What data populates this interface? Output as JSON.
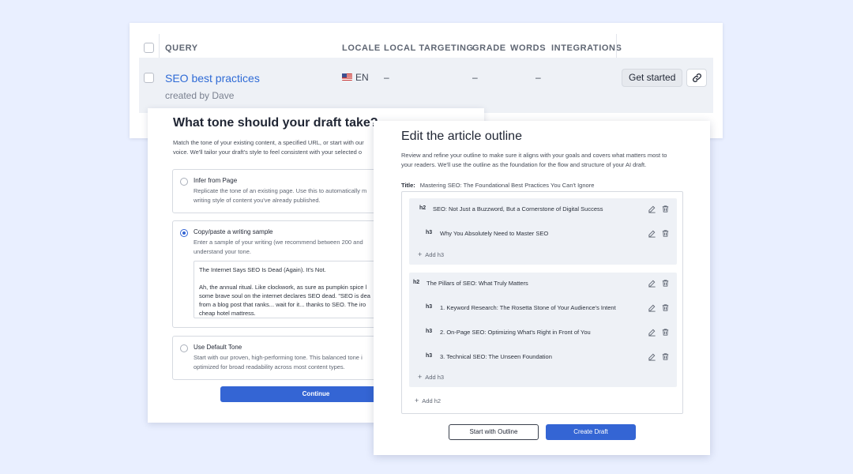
{
  "table": {
    "columns": [
      "QUERY",
      "LOCALE",
      "LOCAL TARGETING",
      "GRADE",
      "WORDS",
      "INTEGRATIONS"
    ],
    "row": {
      "query": "SEO best practices",
      "created_by": "created by Dave",
      "flag": "us-flag-icon",
      "locale": "EN",
      "local_targeting": "–",
      "grade": "–",
      "words": "–",
      "action_label": "Get started"
    }
  },
  "tone": {
    "title": "What tone should your draft take?",
    "desc_line1": "Match the tone of your existing content, a specified URL, or start with our",
    "desc_line2": "voice. We'll tailor your draft's style to feel consistent with your selected o",
    "options": [
      {
        "title": "Infer from Page",
        "desc1": "Replicate the tone of an existing page. Use this to automatically m",
        "desc2": "writing style of content you've already published.",
        "selected": false
      },
      {
        "title": "Copy/paste a writing sample",
        "desc1": "Enter a sample of your writing (we recommend between 200 and",
        "desc2": "understand your tone.",
        "selected": true
      },
      {
        "title": "Use Default Tone",
        "desc1": "Start with our proven, high-performing tone. This balanced tone i",
        "desc2": "optimized for broad readability across most content types.",
        "selected": false
      }
    ],
    "sample": {
      "line1": "The Internet Says SEO Is Dead (Again). It's Not.",
      "line2": "Ah, the annual ritual. Like clockwork, as sure as pumpkin spice l",
      "line3": "some brave soul on the internet declares SEO dead. \"SEO is dea",
      "line4": "from a blog post that ranks... wait for it... thanks to SEO. The iro",
      "line5": "cheap hotel mattress."
    },
    "continue_label": "Continue"
  },
  "outline": {
    "title": "Edit the article outline",
    "desc_line1": "Review and refine your outline to make sure it aligns with your goals and covers what matters most to",
    "desc_line2": "your readers. We'll use the outline as the foundation for the flow and structure of your AI draft.",
    "title_label": "Title:",
    "title_value": "Mastering SEO: The Foundational Best Practices You Can't Ignore",
    "sections": [
      {
        "h2": "SEO: Not Just a Buzzword, But a Cornerstone of Digital Success",
        "h3": [
          "Why You Absolutely Need to Master SEO"
        ]
      },
      {
        "h2": "The Pillars of SEO: What Truly Matters",
        "h3": [
          "1. Keyword Research: The Rosetta Stone of Your Audience's Intent",
          "2. On-Page SEO: Optimizing What's Right in Front of You",
          "3. Technical SEO: The Unseen Foundation"
        ]
      }
    ],
    "h2_tag": "h2",
    "h3_tag": "h3",
    "add_h3": "Add h3",
    "add_h2": "Add h2",
    "start_with_outline_label": "Start with Outline",
    "create_draft_label": "Create Draft"
  }
}
